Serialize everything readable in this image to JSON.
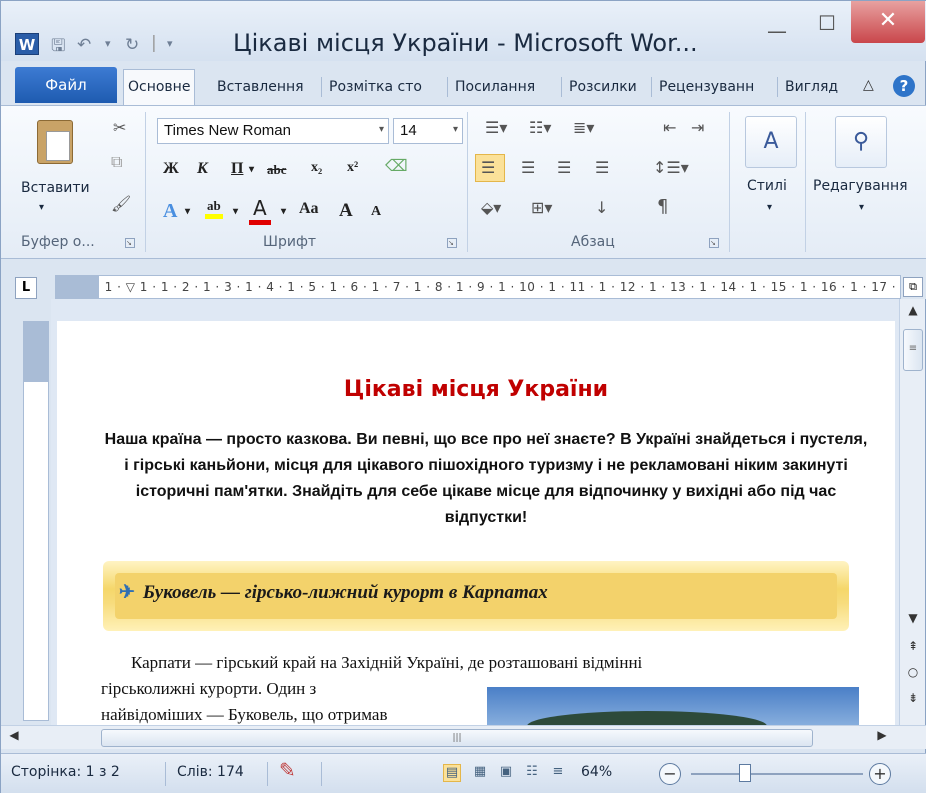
{
  "app": {
    "title": "Цікаві місця України  -  Microsoft Wor...",
    "icon_letter": "W"
  },
  "quick_access": {
    "save_icon": "save-icon",
    "undo_icon": "undo-icon",
    "redo_icon": "redo-icon",
    "customize_icon": "customize-icon"
  },
  "window_controls": {
    "minimize": "—",
    "maximize": "☐",
    "close": "✕"
  },
  "tabs": {
    "file": "Файл",
    "items": [
      "Основне",
      "Вставлення",
      "Розмітка сто",
      "Посилання",
      "Розсилки",
      "Рецензуванн",
      "Вигляд"
    ],
    "active": "Основне",
    "help": "?"
  },
  "ribbon": {
    "clipboard": {
      "paste_label": "Вставити",
      "group_label": "Буфер о..."
    },
    "font": {
      "family": "Times New Roman",
      "size": "14",
      "group_label": "Шрифт",
      "bold": "Ж",
      "italic": "К",
      "underline": "П",
      "strike": "abc",
      "subscript": "x₂",
      "superscript": "x²",
      "grow": "A",
      "shrink": "A",
      "case": "Aa"
    },
    "paragraph": {
      "group_label": "Абзац",
      "pilcrow": "¶"
    },
    "styles": {
      "label": "Стилі"
    },
    "editing": {
      "label": "Редагування"
    }
  },
  "ruler": {
    "corner": "L",
    "marks": "· 1 · ▽ 1 · 1 · 2 · 1 · 3 · 1 · 4 · 1 · 5 · 1 · 6 · 1 · 7 · 1 · 8 · 1 · 9 · 1 · 10 · 1 · 11 · 1 · 12 · 1 · 13 · 1 · 14 · 1 · 15 · 1 · 16 · 1 · 17 · △ 18"
  },
  "document": {
    "title": "Цікаві місця України",
    "intro": "Наша країна — просто казкова. Ви певні, що все про неї знаєте? В Україні знайдеться і пустеля, і гірські каньйони, місця для цікавого пішохідного туризму і не рекламовані ніким закинуті історичні пам'ятки. Знайдіть для себе цікаве місце для відпочинку у вихідні або під час відпустки!",
    "section_heading": "Буковель — гірсько-лижний курорт в Карпатах",
    "body_line1": "Карпати — гірський край на Західній Україні, де розташовані відмінні",
    "body_line2": "гірськолижні     курорти.     Один     з",
    "body_line3": "найвідоміших — Буковель, що отримав"
  },
  "status": {
    "page": "Сторінка: 1 з 2",
    "words": "Слів: 174",
    "zoom": "64%",
    "zoom_level": 0.64
  },
  "colors": {
    "title_red": "#c00000",
    "banner_yellow": "#f3d26b",
    "file_tab_blue": "#1e5bb0"
  }
}
